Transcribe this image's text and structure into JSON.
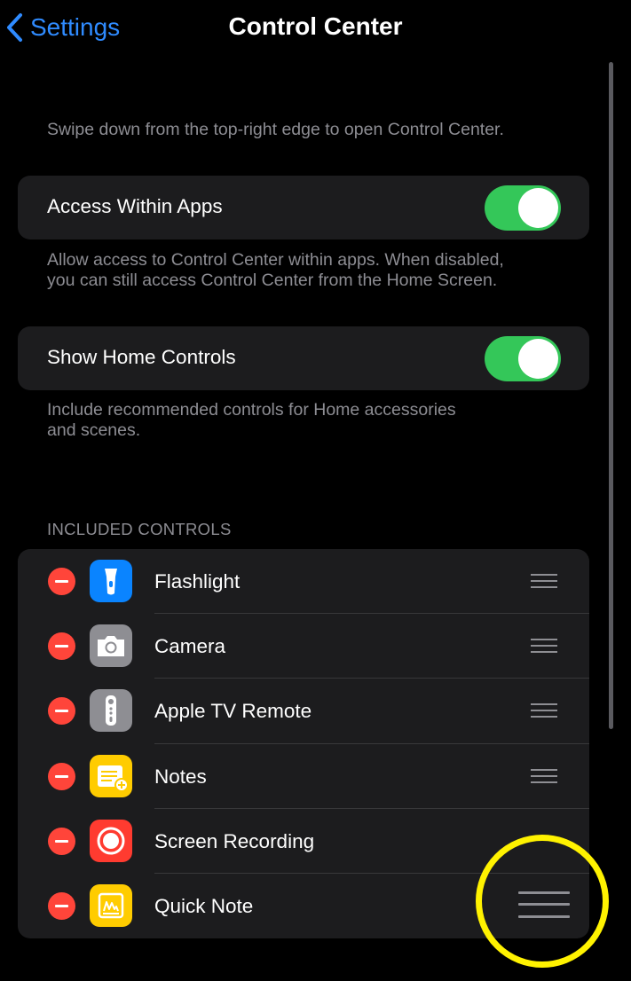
{
  "nav": {
    "back_label": "Settings",
    "title": "Control Center"
  },
  "intro_hint": "Swipe down from the top-right edge to open Control Center.",
  "toggles": [
    {
      "label": "Access Within Apps",
      "on": true,
      "footer_line1": "Allow access to Control Center within apps. When disabled,",
      "footer_line2": "you can still access Control Center from the Home Screen."
    },
    {
      "label": "Show Home Controls",
      "on": true,
      "footer_line1": "Include recommended controls for Home accessories",
      "footer_line2": "and scenes."
    }
  ],
  "included_header": "INCLUDED CONTROLS",
  "controls": [
    {
      "label": "Flashlight",
      "icon": "flashlight-icon",
      "color": "#0a84ff"
    },
    {
      "label": "Camera",
      "icon": "camera-icon",
      "color": "#8e8e93"
    },
    {
      "label": "Apple TV Remote",
      "icon": "remote-icon",
      "color": "#8e8e93"
    },
    {
      "label": "Notes",
      "icon": "notes-icon",
      "color": "#ffcc00"
    },
    {
      "label": "Screen Recording",
      "icon": "record-icon",
      "color": "#ff3b30"
    },
    {
      "label": "Quick Note",
      "icon": "quick-note-icon",
      "color": "#ffcc00"
    }
  ],
  "colors": {
    "accent": "#2f8bff",
    "switch_on": "#34c759",
    "remove": "#ff453a",
    "highlight_ring": "#fff200"
  }
}
